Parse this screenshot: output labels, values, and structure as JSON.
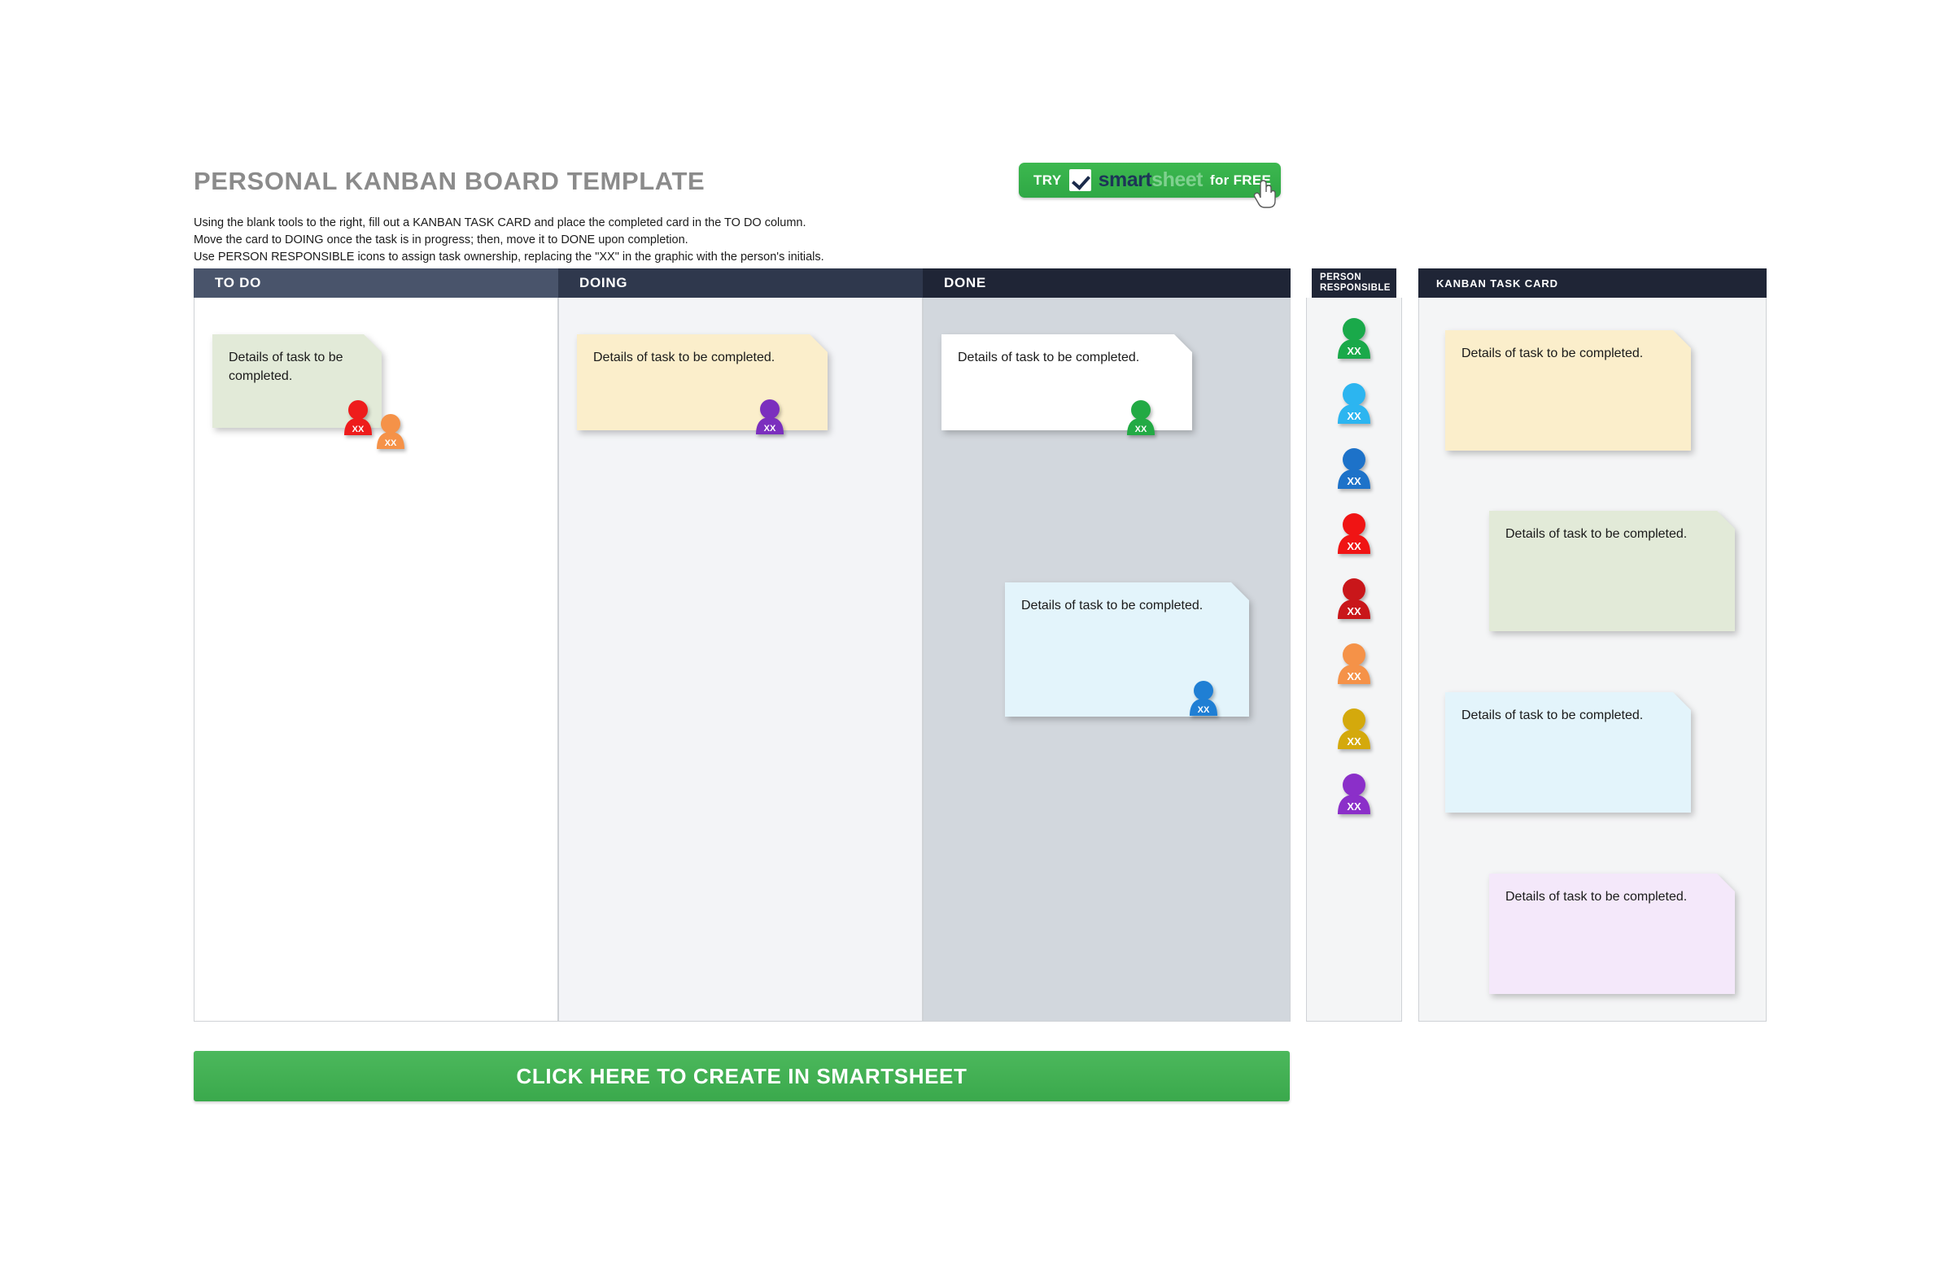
{
  "page_title": "PERSONAL KANBAN BOARD TEMPLATE",
  "instructions": [
    "Using the blank tools to the right, fill out a KANBAN TASK CARD and place the completed card in the TO DO column.",
    "Move the card to DOING once the task is in progress; then, move it to DONE upon completion.",
    "Use PERSON RESPONSIBLE icons to assign task ownership, replacing the \"XX\" in the graphic with the person's initials."
  ],
  "try_pill": {
    "try_label": "TRY",
    "logo_part1": "smart",
    "logo_part2": "sheet",
    "free_label": "for FREE",
    "background_color": "#3cb84f",
    "checkbox_icon": "checkbox-checked-icon",
    "cursor_icon": "hand-cursor-icon"
  },
  "columns": [
    {
      "id": "todo",
      "header": "TO DO",
      "header_color": "#49546b",
      "body_color": "#ffffff",
      "cards": [
        {
          "text": "Details of task to be completed.",
          "color": "#e2ead8",
          "people": [
            {
              "initials": "XX",
              "color": "#ee1c1c"
            },
            {
              "initials": "XX",
              "color": "#f59248"
            }
          ]
        }
      ]
    },
    {
      "id": "doing",
      "header": "DOING",
      "header_color": "#2f384d",
      "body_color": "#f3f4f7",
      "cards": [
        {
          "text": "Details of task to be completed.",
          "color": "#fbeecb",
          "people": [
            {
              "initials": "XX",
              "color": "#7b2fbe"
            }
          ]
        }
      ]
    },
    {
      "id": "done",
      "header": "DONE",
      "header_color": "#1f2536",
      "body_color": "#d2d7dd",
      "cards": [
        {
          "text": "Details of task to be completed.",
          "color": "#ffffff",
          "people": [
            {
              "initials": "XX",
              "color": "#22aa44"
            }
          ]
        },
        {
          "text": "Details of task to be completed.",
          "color": "#e3f4fb",
          "people": [
            {
              "initials": "XX",
              "color": "#1f7fd4"
            }
          ]
        }
      ]
    }
  ],
  "person_responsible": {
    "header_line1": "PERSON",
    "header_line2": "RESPONSIBLE",
    "header_color": "#1f2536",
    "icons": [
      {
        "initials": "XX",
        "color": "#1aa94a"
      },
      {
        "initials": "XX",
        "color": "#2cb5f0"
      },
      {
        "initials": "XX",
        "color": "#1d72c9"
      },
      {
        "initials": "XX",
        "color": "#f01414"
      },
      {
        "initials": "XX",
        "color": "#c9161a"
      },
      {
        "initials": "XX",
        "color": "#f59248"
      },
      {
        "initials": "XX",
        "color": "#d4a90c"
      },
      {
        "initials": "XX",
        "color": "#8b2fc9"
      }
    ]
  },
  "kanban_task_card": {
    "header": "KANBAN TASK CARD",
    "header_color": "#1f2536",
    "cards": [
      {
        "text": "Details of task to be completed.",
        "color": "#fbeecb"
      },
      {
        "text": "Details of task to be completed.",
        "color": "#e2ead8"
      },
      {
        "text": "Details of task to be completed.",
        "color": "#e3f4fb"
      },
      {
        "text": "Details of task to be completed.",
        "color": "#f4e8fa"
      }
    ]
  },
  "cta": {
    "label": "CLICK HERE TO CREATE IN SMARTSHEET",
    "color": "#4cb85c"
  }
}
